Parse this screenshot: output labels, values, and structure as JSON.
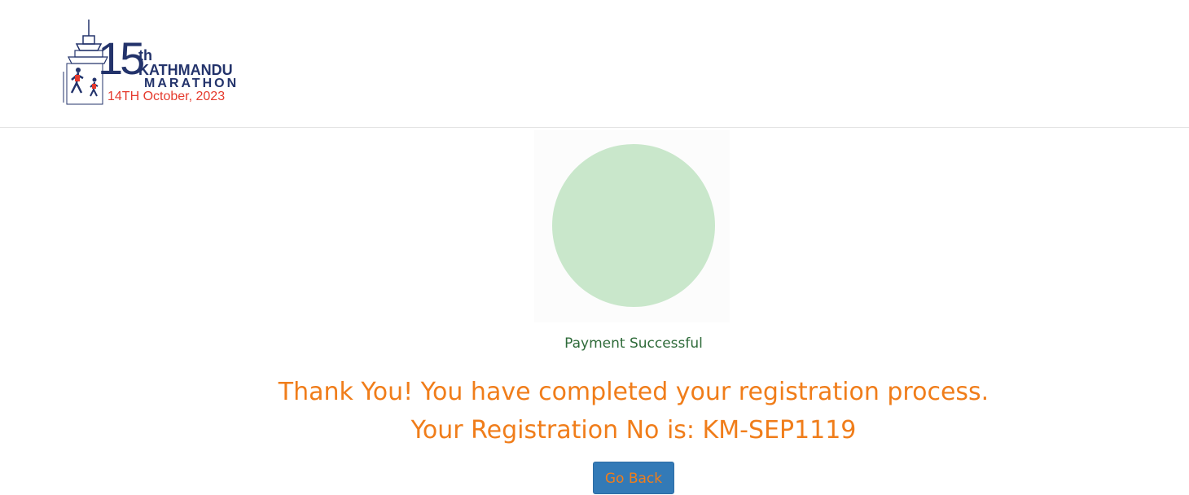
{
  "header": {
    "logo": {
      "number": "15",
      "suffix": "th",
      "line1": "KATHMANDU",
      "line2": "MARATHON",
      "date": "14TH October, 2023"
    }
  },
  "main": {
    "status_text": "Payment Successful",
    "message_line1": "Thank You! You have completed your registration process.",
    "message_line2": "Your Registration No is: KM-SEP1119",
    "button_label": "Go Back"
  },
  "colors": {
    "accent": "#f07d1a",
    "success_text": "#2f6b3a",
    "success_circle": "#c9e7cb",
    "button_bg": "#337ab7",
    "logo_blue": "#23336b",
    "logo_red": "#e53a2d"
  }
}
